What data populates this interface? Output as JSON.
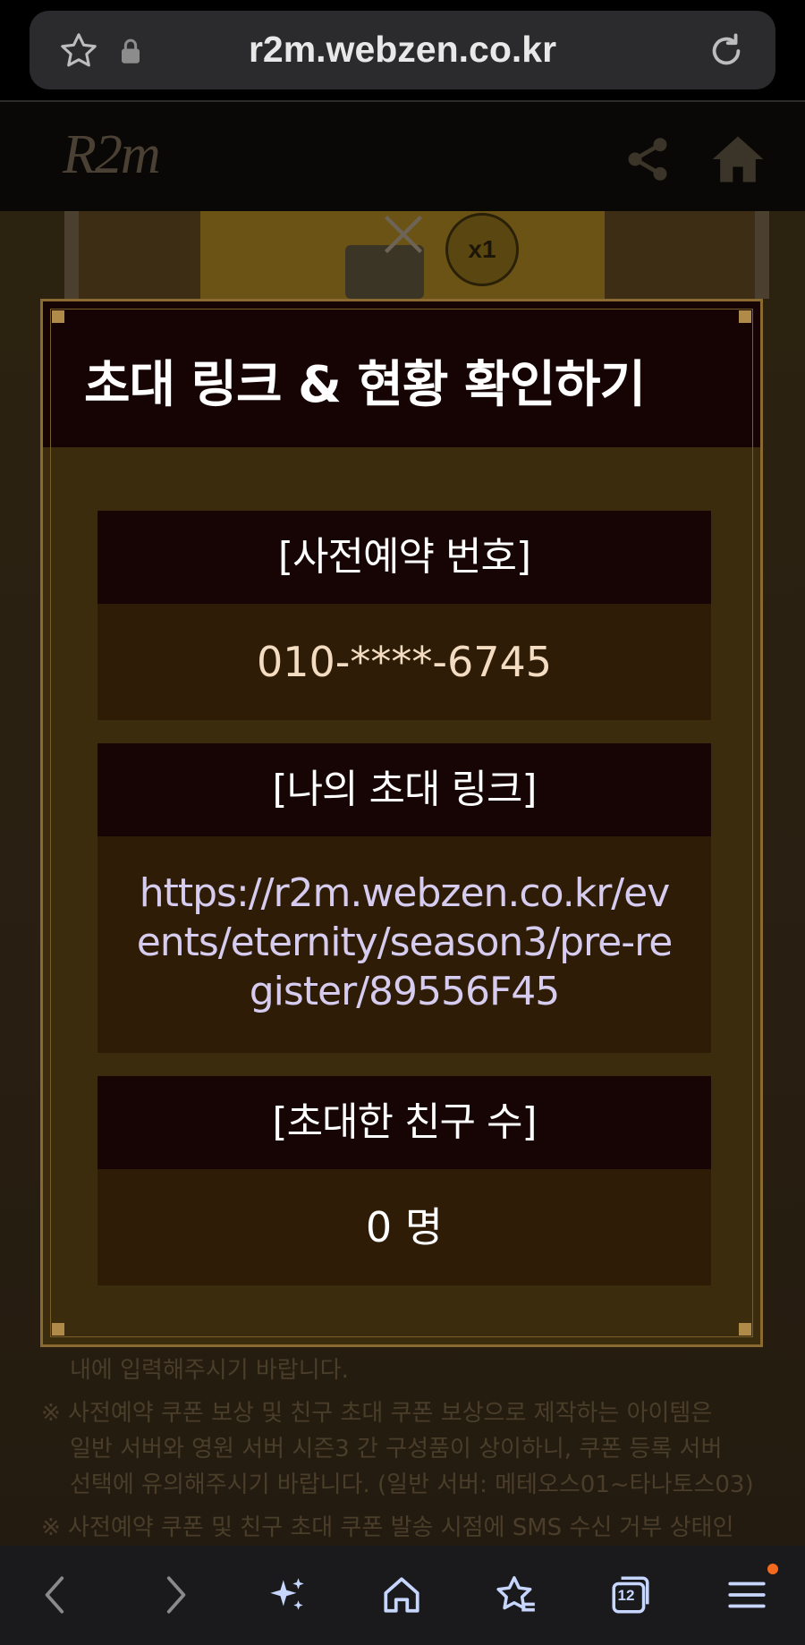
{
  "browser": {
    "url": "r2m.webzen.co.kr",
    "tab_count": "12"
  },
  "site": {
    "logo_text": "R2m",
    "badge": "x1"
  },
  "modal": {
    "title": "초대 링크 & 현황 확인하기",
    "sections": [
      {
        "heading": "[사전예약 번호]",
        "value": "010-****-6745"
      },
      {
        "heading": "[나의 초대 링크]",
        "value_lines": [
          "https://r2m.webzen.co.kr/ev",
          "ents/eternity/season3/pre-re",
          "gister/89556F45"
        ]
      },
      {
        "heading": "[초대한 친구 수]",
        "value": "0 명"
      }
    ]
  },
  "background_notes": [
    "내에 입력해주시기 바랍니다.",
    "※ 사전예약 쿠폰 보상 및 친구 초대 쿠폰 보상으로 제작하는 아이템은",
    "일반 서버와 영원 서버 시즌3 간 구성품이 상이하니, 쿠폰 등록 서버",
    "선택에 유의해주시기 바랍니다. (일반 서버: 메테오스01~타나토스03)",
    "※ 사전예약 쿠폰 및 친구 초대 쿠폰 발송 시점에 SMS 수신 거부 상태인"
  ],
  "colors": {
    "modal_header": "#160404",
    "modal_body": "#3a2c0c",
    "section_body": "#2e1c06",
    "link_text": "#d6ccf0",
    "notification_dot": "#f26a1e"
  }
}
